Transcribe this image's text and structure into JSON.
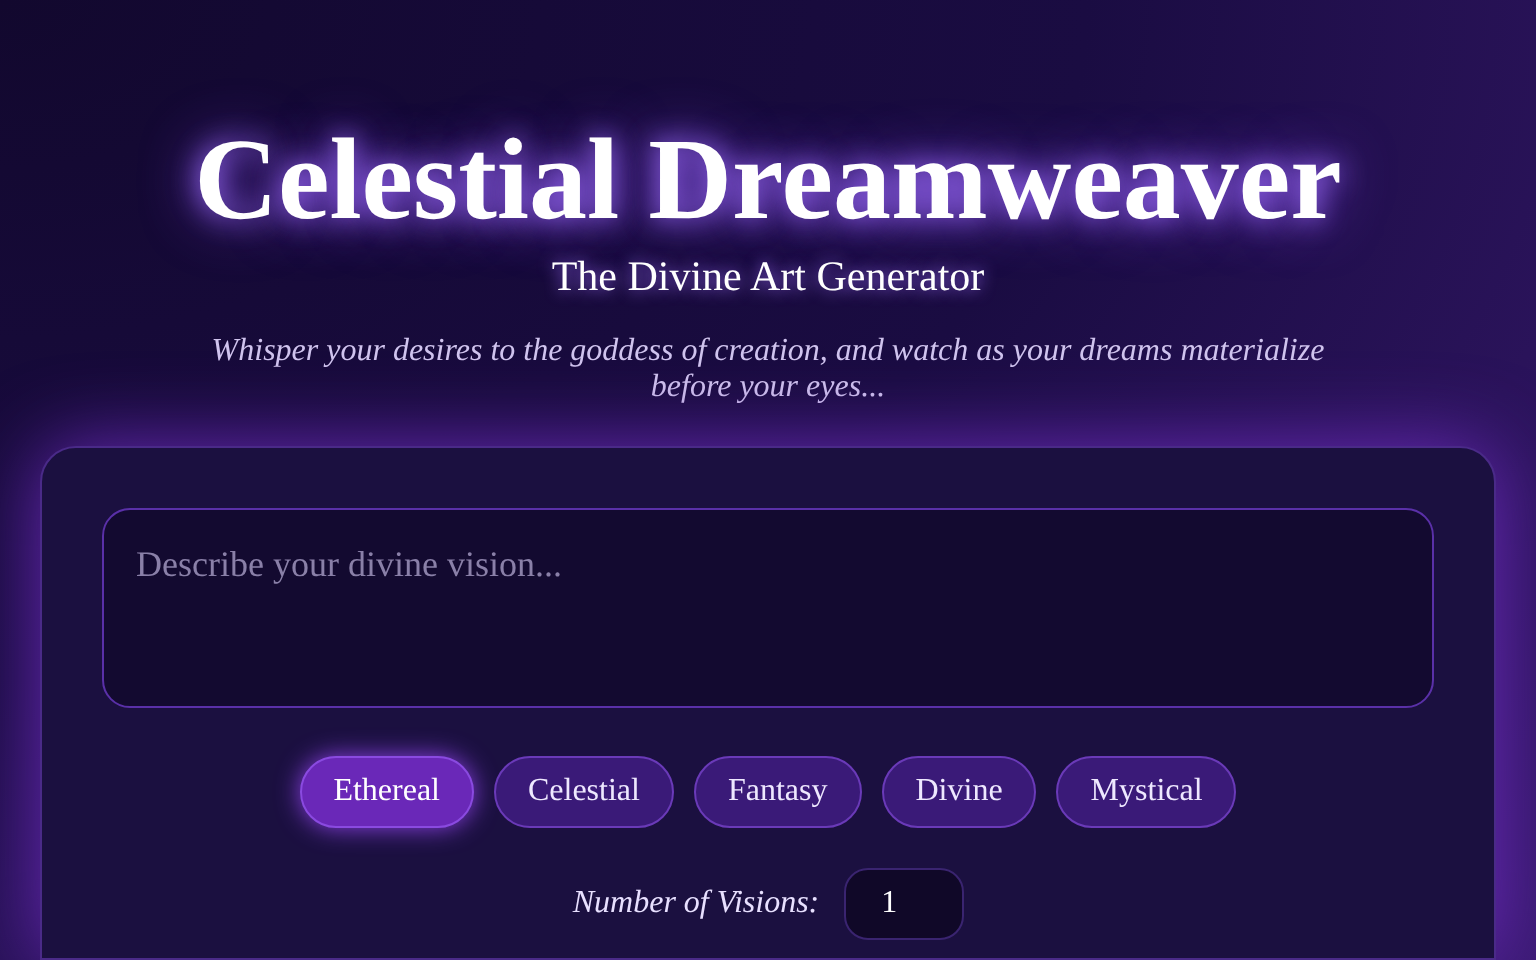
{
  "header": {
    "title": "Celestial Dreamweaver",
    "subtitle": "The Divine Art Generator",
    "tagline": "Whisper your desires to the goddess of creation, and watch as your dreams materialize before your eyes..."
  },
  "prompt": {
    "placeholder": "Describe your divine vision..."
  },
  "styles": [
    {
      "label": "Ethereal",
      "selected": true
    },
    {
      "label": "Celestial",
      "selected": false
    },
    {
      "label": "Fantasy",
      "selected": false
    },
    {
      "label": "Divine",
      "selected": false
    },
    {
      "label": "Mystical",
      "selected": false
    }
  ],
  "count": {
    "label": "Number of Visions:",
    "value": "1"
  }
}
